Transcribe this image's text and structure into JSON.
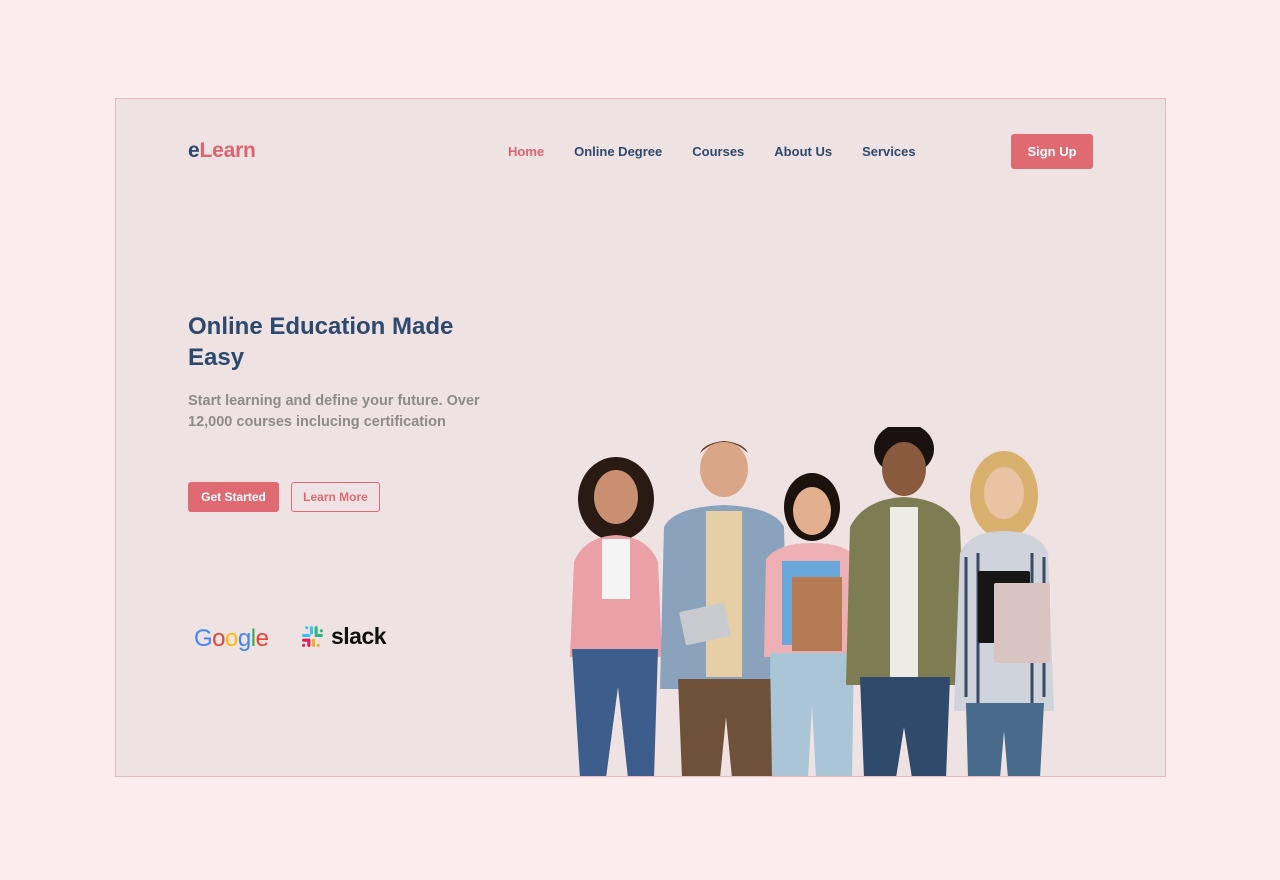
{
  "brand": {
    "logo_e": "e",
    "logo_rest": "Learn"
  },
  "nav": {
    "items": [
      {
        "label": "Home",
        "active": true
      },
      {
        "label": "Online Degree",
        "active": false
      },
      {
        "label": "Courses",
        "active": false
      },
      {
        "label": "About Us",
        "active": false
      },
      {
        "label": "Services",
        "active": false
      }
    ]
  },
  "header": {
    "signup_label": "Sign Up"
  },
  "hero": {
    "title": "Online Education Made Easy",
    "subtitle": "Start learning and define your future. Over 12,000 courses inclucing certification",
    "primary_cta": "Get Started",
    "secondary_cta": "Learn More"
  },
  "partners": {
    "google": {
      "letters": [
        "G",
        "o",
        "o",
        "g",
        "l",
        "e"
      ],
      "colors": [
        "#4285f4",
        "#ea4335",
        "#fbbc05",
        "#4285f4",
        "#34a853",
        "#ea4335"
      ]
    },
    "slack": {
      "label": "slack"
    }
  },
  "colors": {
    "page_bg": "#fcecee",
    "frame_bg": "#efe2e2",
    "accent": "#df6a72",
    "navy": "#2d4a6e",
    "muted_text": "#8e8b8b"
  },
  "image": {
    "subject": "students-group-photo"
  }
}
